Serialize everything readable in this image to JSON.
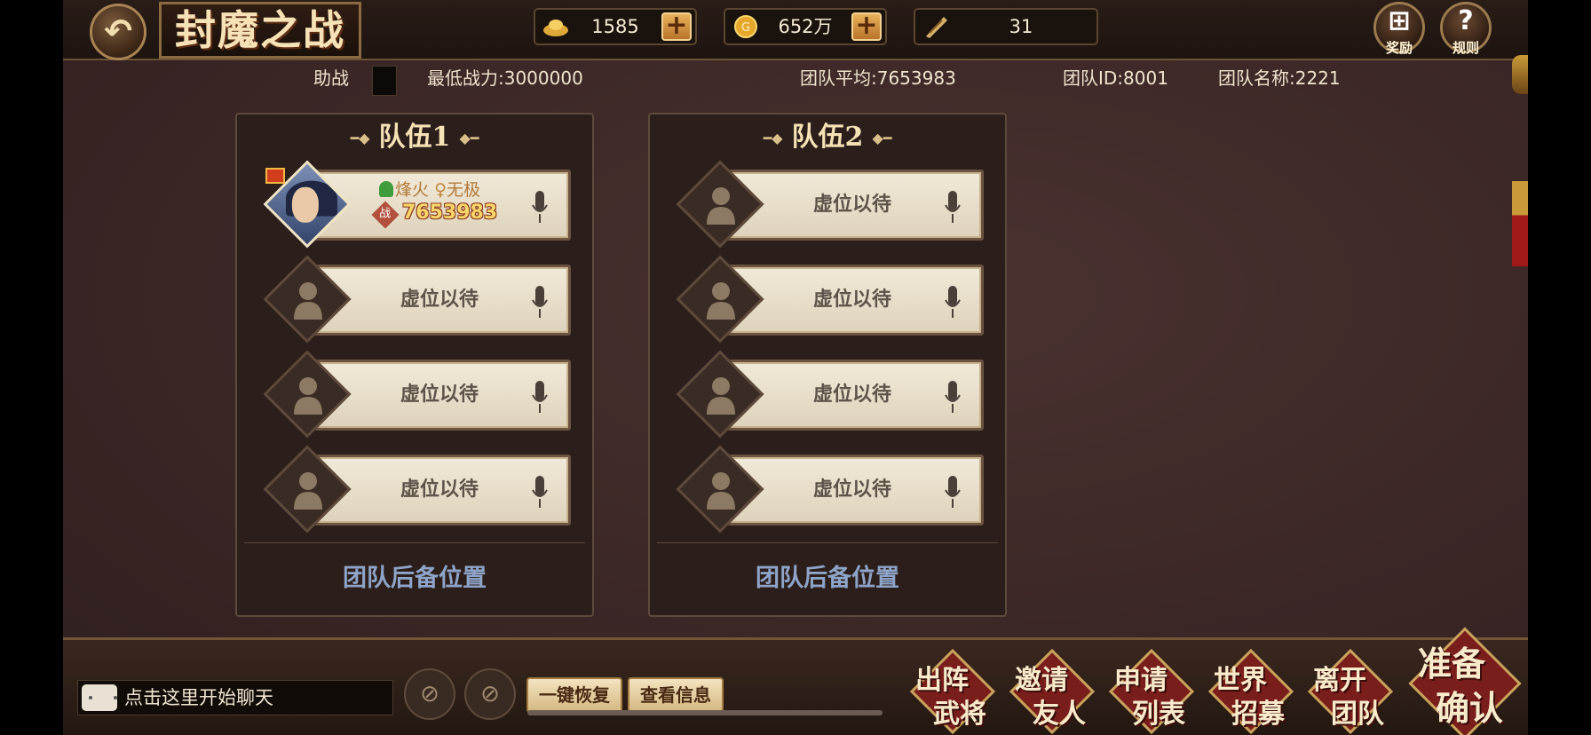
{
  "header": {
    "back_icon": "back-arrow-icon",
    "title": "封魔之战",
    "resources": [
      {
        "name": "ingot",
        "icon": "gold-ingot-icon",
        "value": "1585"
      },
      {
        "name": "coin",
        "icon": "gold-coin-icon",
        "value": "652万"
      },
      {
        "name": "token",
        "icon": "feather-token-icon",
        "value": "31"
      }
    ],
    "reward_label": "奖励",
    "rules_label": "规则"
  },
  "info": {
    "assist_label": "助战",
    "min_power": "最低战力:3000000",
    "team_average": "团队平均:7653983",
    "team_id": "团队ID:8001",
    "team_name": "团队名称:2221"
  },
  "teams": [
    {
      "title": "队伍1",
      "slots": [
        {
          "filled": true,
          "name": "烽火",
          "title": "无极",
          "power": "7653983"
        },
        {
          "filled": false,
          "label": "虚位以待"
        },
        {
          "filled": false,
          "label": "虚位以待"
        },
        {
          "filled": false,
          "label": "虚位以待"
        }
      ],
      "reserve": "团队后备位置"
    },
    {
      "title": "队伍2",
      "slots": [
        {
          "filled": false,
          "label": "虚位以待"
        },
        {
          "filled": false,
          "label": "虚位以待"
        },
        {
          "filled": false,
          "label": "虚位以待"
        },
        {
          "filled": false,
          "label": "虚位以待"
        }
      ],
      "reserve": "团队后备位置"
    }
  ],
  "power_badge": "战",
  "bottom": {
    "chat_placeholder": "点击这里开始聊天",
    "restore_button": "一键恢复",
    "view_info_button": "查看信息",
    "actions": [
      {
        "l1": "出阵",
        "l2": "武将"
      },
      {
        "l1": "邀请",
        "l2": "友人"
      },
      {
        "l1": "申请",
        "l2": "列表"
      },
      {
        "l1": "世界",
        "l2": "招募"
      },
      {
        "l1": "离开",
        "l2": "团队"
      },
      {
        "l1": "准备",
        "l2": "确认"
      }
    ]
  },
  "colors": {
    "background": "#3b2726",
    "accent_gold": "#f5e3b5",
    "reserve_text": "#8ea4c8",
    "action_red": "#7a1e1b"
  }
}
